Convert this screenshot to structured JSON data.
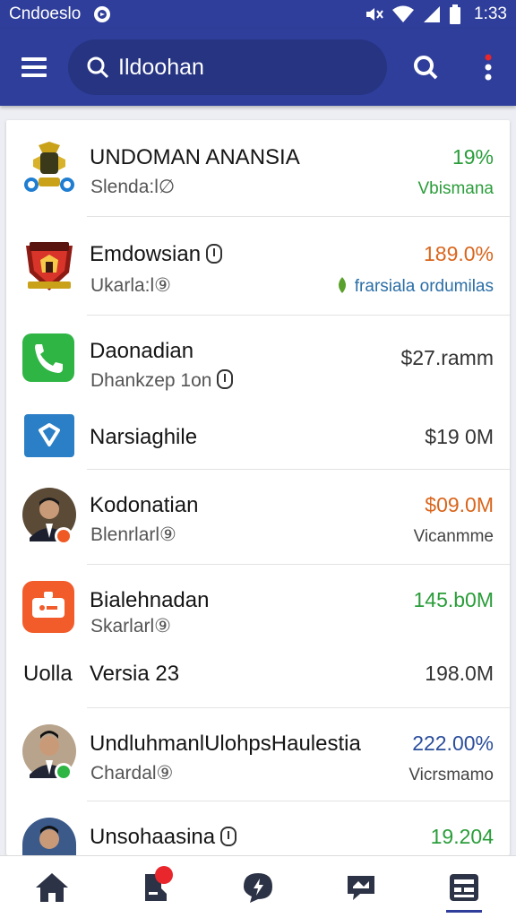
{
  "status_bar": {
    "carrier": "Cndoeslo",
    "time": "1:33"
  },
  "search": {
    "value": "",
    "placeholder": "Ildoohan"
  },
  "colors": {
    "primary": "#2f3e9a",
    "green": "#2a9d3a",
    "orange": "#d9651c",
    "blue": "#2b4e9c",
    "badge": "#e8262b"
  },
  "list": [
    {
      "title": "UNDOMAN ANANSIA",
      "sub": "Slenda:l∅",
      "value": "19%",
      "value_color": "#2a9d3a",
      "status": "Vbismana",
      "status_color": "#2a9d3a",
      "icon": "gold-emblem-icon"
    },
    {
      "title": "Emdowsian",
      "sub": "Ukarla:l⑨",
      "value": "189.0%",
      "value_color": "#d9651c",
      "status": "frarsiala ordumilas",
      "status_color": "#2b6ea6",
      "icon": "red-crest-icon"
    },
    {
      "title": "Daonadian",
      "sub": "Dhankzep 1on",
      "value": "$27.ramm",
      "value_color": "#333333",
      "status": "",
      "status_color": "#333333",
      "icon": "phone-app-icon"
    },
    {
      "title": "Narsiaghile",
      "sub": "",
      "value": "$19 0M",
      "value_color": "#333333",
      "status": "",
      "status_color": "#333333",
      "icon": "shield-app-icon"
    },
    {
      "title": "Kodonatian",
      "sub": "Blenrlarl⑨",
      "value": "$09.0M",
      "value_color": "#d9651c",
      "status": "Vicanmme",
      "status_color": "#444444",
      "icon": "person-photo-icon"
    },
    {
      "title": "Bialehnadan",
      "sub": "Skarlarl⑨",
      "value": "145.b0M",
      "value_color": "#2a9d3a",
      "status": "",
      "status_color": "#444444",
      "icon": "video-app-icon"
    },
    {
      "title": "Versia 23",
      "sub": "",
      "prefix": "Uolla",
      "value": "198.0M",
      "value_color": "#333333",
      "status": "",
      "status_color": "#444444",
      "icon": ""
    },
    {
      "title": "UndluhmanlUlohpsHaulestia",
      "sub": "Chardal⑨",
      "value": "222.00%",
      "value_color": "#2b4e9c",
      "status": "Vicrsmamo",
      "status_color": "#444444",
      "icon": "person-photo-icon"
    },
    {
      "title": "Unsohaasina",
      "sub": "",
      "value": "19.204",
      "value_color": "#2a9d3a",
      "status": "",
      "status_color": "#444444",
      "icon": "person-photo-icon"
    }
  ],
  "nav": [
    "home",
    "notifications",
    "chat",
    "messages",
    "menu"
  ]
}
